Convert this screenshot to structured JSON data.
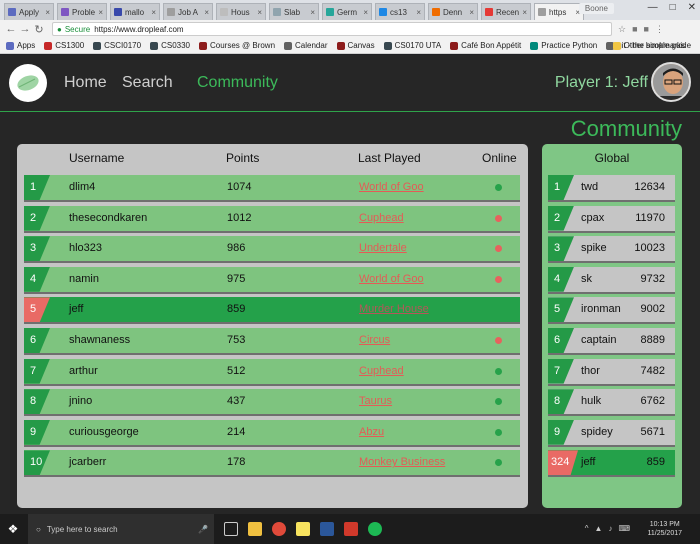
{
  "browser": {
    "tabs": [
      {
        "label": "Apply",
        "color": "#5c6bc0"
      },
      {
        "label": "Proble",
        "color": "#7e57c2"
      },
      {
        "label": "mallo",
        "color": "#3949ab"
      },
      {
        "label": "Job A",
        "color": "#9e9e9e"
      },
      {
        "label": "Hous",
        "color": "#bdbdbd"
      },
      {
        "label": "Slab",
        "color": "#90a4ae"
      },
      {
        "label": "Germ",
        "color": "#26a69a"
      },
      {
        "label": "cs13",
        "color": "#1e88e5"
      },
      {
        "label": "Denn",
        "color": "#ef6c00"
      },
      {
        "label": "Recen",
        "color": "#e53935"
      },
      {
        "label": "https",
        "color": "#9e9e9e"
      }
    ],
    "profile": "Boone",
    "address": {
      "secure_label": "Secure",
      "url": "https://www.dropleaf.com"
    },
    "bookmarks": [
      {
        "label": "Apps",
        "color": "#5c6bc0"
      },
      {
        "label": "CS1300",
        "color": "#c62828"
      },
      {
        "label": "CSCI0170",
        "color": "#37474f"
      },
      {
        "label": "CS0330",
        "color": "#37474f"
      },
      {
        "label": "Courses @ Brown",
        "color": "#8d1c1c"
      },
      {
        "label": "Calendar",
        "color": "#616161"
      },
      {
        "label": "Canvas",
        "color": "#8d1c1c"
      },
      {
        "label": "CS0170 UTA",
        "color": "#37474f"
      },
      {
        "label": "Café Bon Appétit",
        "color": "#8d1c1c"
      },
      {
        "label": "Practice Python",
        "color": "#00897b"
      },
      {
        "label": "git - the simple guide",
        "color": "#616161"
      }
    ],
    "other_bookmarks": "Other bookmarks"
  },
  "nav": {
    "home": "Home",
    "search": "Search",
    "community": "Community",
    "player": "Player 1: Jeff"
  },
  "page_title": "Community",
  "leaderboard": {
    "headers": {
      "username": "Username",
      "points": "Points",
      "last_played": "Last Played",
      "online": "Online"
    },
    "rows": [
      {
        "rank": "1",
        "username": "dlim4",
        "points": "1074",
        "game": "World of Goo",
        "online": true
      },
      {
        "rank": "2",
        "username": "thesecondkaren",
        "points": "1012",
        "game": "Cuphead",
        "online": false
      },
      {
        "rank": "3",
        "username": "hlo323",
        "points": "986",
        "game": "Undertale",
        "online": false
      },
      {
        "rank": "4",
        "username": "namin",
        "points": "975",
        "game": "World of Goo",
        "online": false
      },
      {
        "rank": "5",
        "username": "jeff",
        "points": "859",
        "game": "Murder House",
        "online": null,
        "me": true
      },
      {
        "rank": "6",
        "username": "shawnaness",
        "points": "753",
        "game": "Circus",
        "online": false
      },
      {
        "rank": "7",
        "username": "arthur",
        "points": "512",
        "game": "Cuphead",
        "online": true
      },
      {
        "rank": "8",
        "username": "jnino",
        "points": "437",
        "game": "Taurus",
        "online": true
      },
      {
        "rank": "9",
        "username": "curiousgeorge",
        "points": "214",
        "game": "Abzu",
        "online": true
      },
      {
        "rank": "10",
        "username": "jcarberr",
        "points": "178",
        "game": "Monkey Business",
        "online": true
      }
    ]
  },
  "global": {
    "header": "Global",
    "rows": [
      {
        "rank": "1",
        "username": "twd",
        "points": "12634"
      },
      {
        "rank": "2",
        "username": "cpax",
        "points": "11970"
      },
      {
        "rank": "3",
        "username": "spike",
        "points": "10023"
      },
      {
        "rank": "4",
        "username": "sk",
        "points": "9732"
      },
      {
        "rank": "5",
        "username": "ironman",
        "points": "9002"
      },
      {
        "rank": "6",
        "username": "captain",
        "points": "8889"
      },
      {
        "rank": "7",
        "username": "thor",
        "points": "7482"
      },
      {
        "rank": "8",
        "username": "hulk",
        "points": "6762"
      },
      {
        "rank": "9",
        "username": "spidey",
        "points": "5671"
      },
      {
        "rank": "324",
        "username": "jeff",
        "points": "859",
        "me": true
      }
    ]
  },
  "colors": {
    "online": "#27a24a",
    "offline": "#e7625e",
    "accent": "#3cba5a"
  },
  "taskbar": {
    "search_placeholder": "Type here to search",
    "time": "10:13 PM",
    "date": "11/25/2017"
  }
}
